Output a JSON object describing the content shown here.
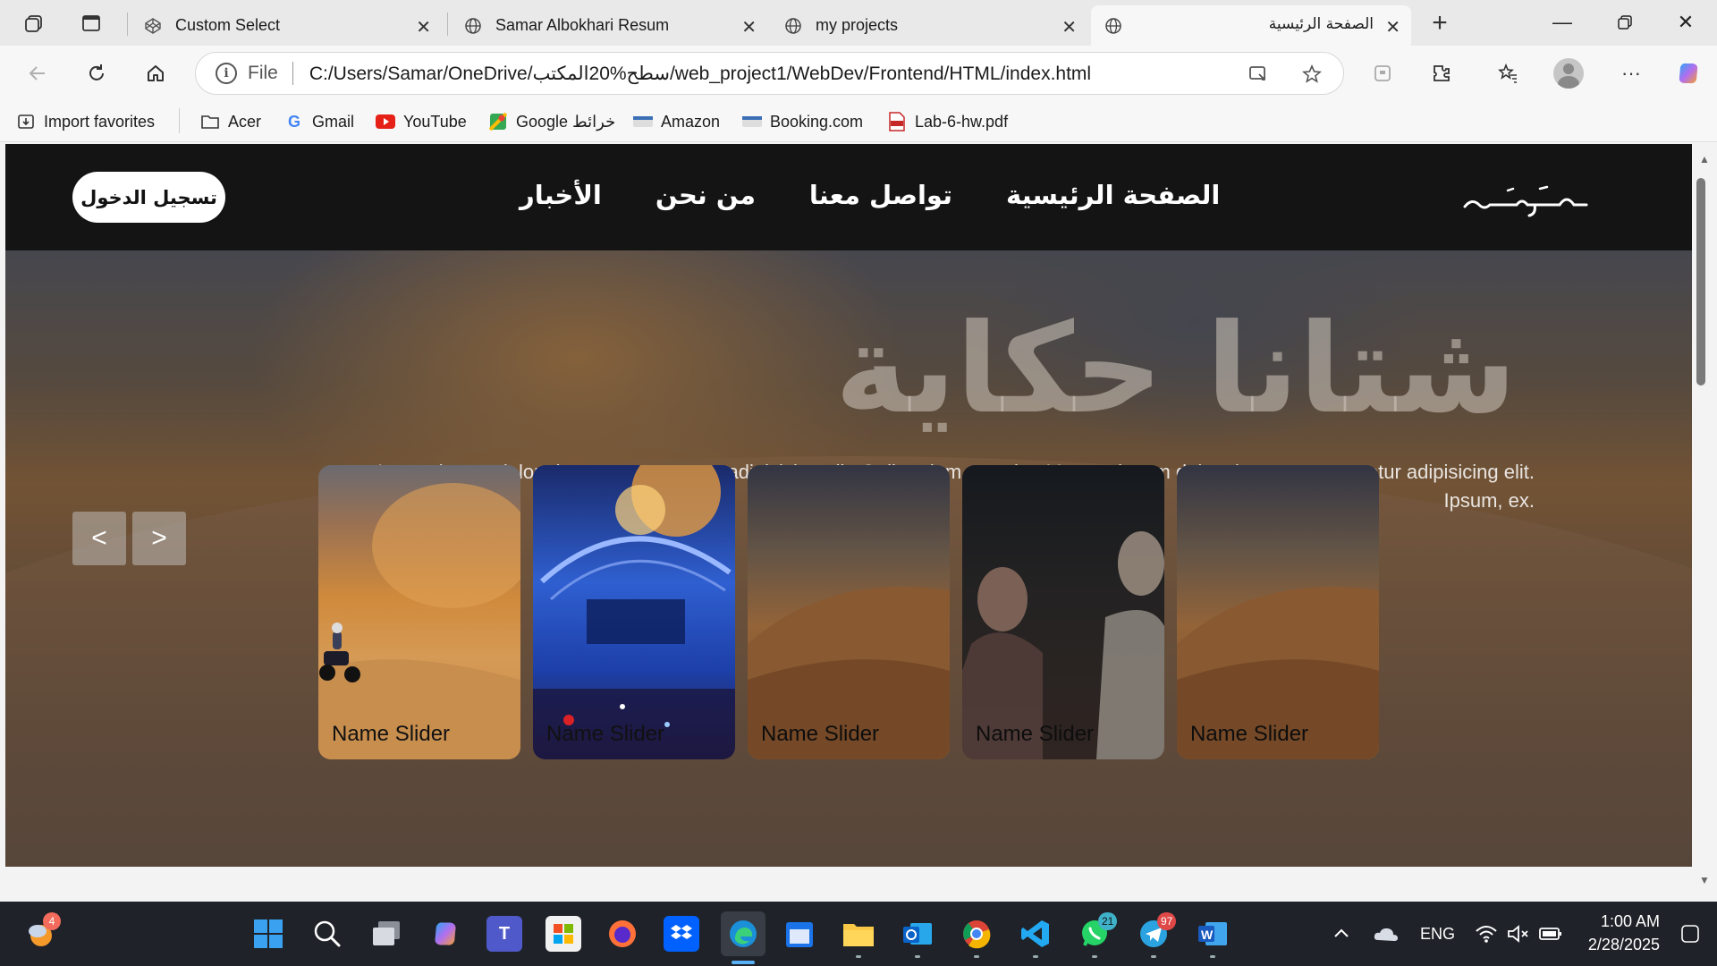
{
  "browser": {
    "tabs": [
      {
        "title": "Custom Select",
        "active": false
      },
      {
        "title": "Samar Albokhari Resum",
        "active": false
      },
      {
        "title": "my projects",
        "active": false
      },
      {
        "title": "الصفحة الرئيسية",
        "active": true
      }
    ],
    "address": {
      "scheme": "File",
      "url": "C:/Users/Samar/OneDrive/سطح%20المكتب/web_project1/WebDev/Frontend/HTML/index.html"
    },
    "favorites": [
      {
        "label": "Import favorites",
        "icon": "import-icon"
      },
      {
        "label": "Acer",
        "icon": "folder-icon"
      },
      {
        "label": "Gmail",
        "icon": "google-icon"
      },
      {
        "label": "YouTube",
        "icon": "youtube-icon"
      },
      {
        "label": "Google خرائط",
        "icon": "maps-icon"
      },
      {
        "label": "Amazon",
        "icon": "amazon-icon"
      },
      {
        "label": "Booking.com",
        "icon": "booking-icon"
      },
      {
        "label": "Lab-6-hw.pdf",
        "icon": "pdf-icon"
      }
    ]
  },
  "site": {
    "login_label": "تسجيل الدخول",
    "nav": [
      "الصفحة الرئيسية",
      "تواصل معنا",
      "من نحن",
      "الأخبار"
    ],
    "logo_text": "مـسـرد",
    "hero_title": "شتانا حكاية",
    "hero_desc_line1": "Lorem ipsum dolor sit amet consectetur adipisicing elit. Quibusdam, nesciunt! Lorem ipsum dolor sit amet consectetur adipisicing elit.",
    "hero_desc_line2": "Ipsum, ex.",
    "prev_label": "<",
    "next_label": ">",
    "cards": [
      {
        "name": "Name Slider",
        "image": "desert-quad-bike"
      },
      {
        "name": "Name Slider",
        "image": "festival-stage-lights"
      },
      {
        "name": "Name Slider",
        "image": "desert-dunes-sunset"
      },
      {
        "name": "Name Slider",
        "image": "couple-at-night"
      },
      {
        "name": "Name Slider",
        "image": "desert-dunes-sunset"
      }
    ]
  },
  "taskbar": {
    "weather_badge": "4",
    "whatsapp_badge": "21",
    "telegram_badge": "97",
    "language": "ENG",
    "time": "1:00 AM",
    "date": "2/28/2025"
  },
  "colors": {
    "header_bg": "#141414",
    "accent_edge": "#0a64c8"
  }
}
